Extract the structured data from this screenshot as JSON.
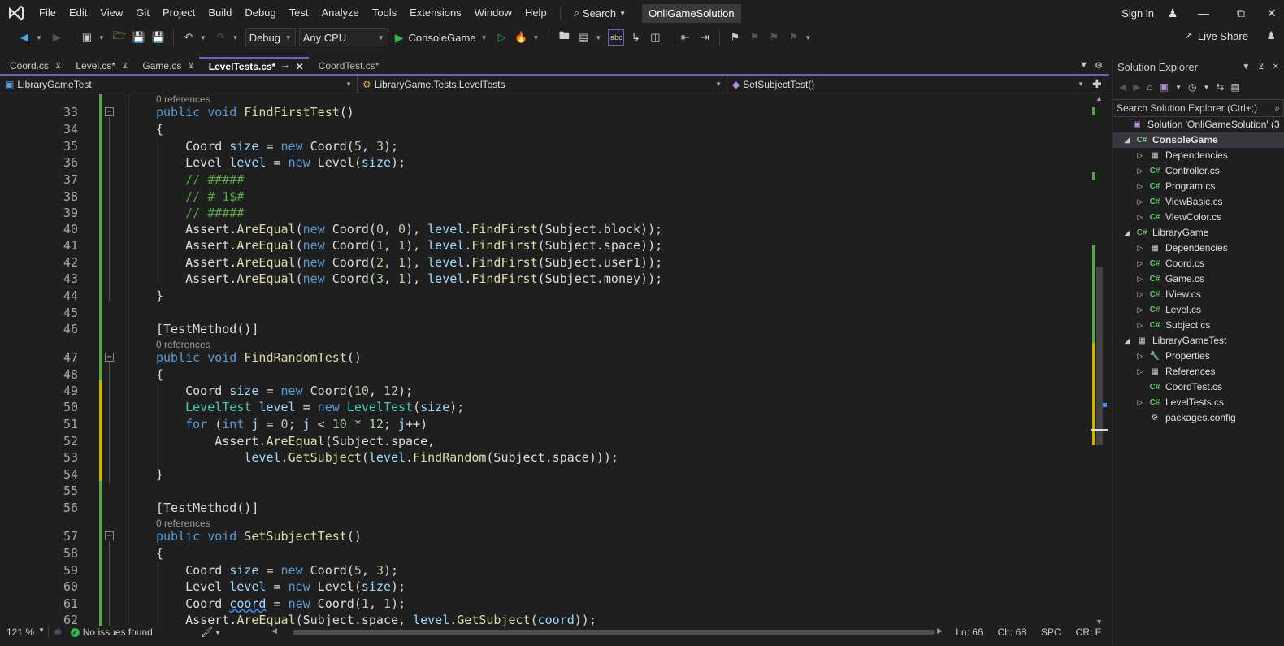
{
  "menubar": {
    "items": [
      "File",
      "Edit",
      "View",
      "Git",
      "Project",
      "Build",
      "Debug",
      "Test",
      "Analyze",
      "Tools",
      "Extensions",
      "Window",
      "Help"
    ],
    "search_label": "Search",
    "solution_name": "OnliGameSolution",
    "sign_in": "Sign in"
  },
  "toolbar": {
    "configuration": "Debug",
    "platform": "Any CPU",
    "startup_project": "ConsoleGame",
    "live_share": "Live Share"
  },
  "tabs": [
    {
      "label": "Coord.cs",
      "active": false
    },
    {
      "label": "Level.cs*",
      "active": false
    },
    {
      "label": "Game.cs",
      "active": false
    },
    {
      "label": "LevelTests.cs*",
      "active": true
    },
    {
      "label": "CoordTest.cs*",
      "active": false
    }
  ],
  "navbar": {
    "project": "LibraryGameTest",
    "class": "LibraryGame.Tests.LevelTests",
    "member": "SetSubjectTest()"
  },
  "editor": {
    "references_label": "0 references",
    "line_numbers": [
      "33",
      "34",
      "35",
      "36",
      "37",
      "38",
      "39",
      "40",
      "41",
      "42",
      "43",
      "44",
      "45",
      "46",
      "47",
      "48",
      "49",
      "50",
      "51",
      "52",
      "53",
      "54",
      "55",
      "56",
      "57",
      "58",
      "59",
      "60",
      "61",
      "62"
    ]
  },
  "statusbar": {
    "zoom": "121 %",
    "issues": "No issues found",
    "line": "Ln: 66",
    "col": "Ch: 68",
    "whitespace": "SPC",
    "line_ending": "CRLF"
  },
  "solution_explorer": {
    "title": "Solution Explorer",
    "search_placeholder": "Search Solution Explorer (Ctrl+;)",
    "solution_label": "Solution 'OnliGameSolution' (3",
    "tree": [
      {
        "label": "ConsoleGame",
        "icon": "project-icon"
      },
      {
        "label": "Dependencies",
        "icon": "dependencies-icon"
      },
      {
        "label": "Controller.cs",
        "icon": "csharp-file-icon"
      },
      {
        "label": "Program.cs",
        "icon": "csharp-file-icon"
      },
      {
        "label": "ViewBasic.cs",
        "icon": "csharp-file-icon"
      },
      {
        "label": "ViewColor.cs",
        "icon": "csharp-file-icon"
      },
      {
        "label": "LibraryGame",
        "icon": "project-icon"
      },
      {
        "label": "Dependencies",
        "icon": "dependencies-icon"
      },
      {
        "label": "Coord.cs",
        "icon": "csharp-file-icon"
      },
      {
        "label": "Game.cs",
        "icon": "csharp-file-icon"
      },
      {
        "label": "IView.cs",
        "icon": "csharp-file-icon"
      },
      {
        "label": "Level.cs",
        "icon": "csharp-file-icon"
      },
      {
        "label": "Subject.cs",
        "icon": "csharp-file-icon"
      },
      {
        "label": "LibraryGameTest",
        "icon": "test-project-icon"
      },
      {
        "label": "Properties",
        "icon": "wrench-icon"
      },
      {
        "label": "References",
        "icon": "references-icon"
      },
      {
        "label": "CoordTest.cs",
        "icon": "csharp-file-icon"
      },
      {
        "label": "LevelTests.cs",
        "icon": "csharp-file-icon"
      },
      {
        "label": "packages.config",
        "icon": "config-file-icon"
      }
    ]
  },
  "colors": {
    "accent": "#6c5fc7",
    "keyword": "#569cd6",
    "comment": "#57a64a",
    "method": "#dcdcaa",
    "change_saved": "#57a64a",
    "change_unsaved": "#c8b400"
  }
}
